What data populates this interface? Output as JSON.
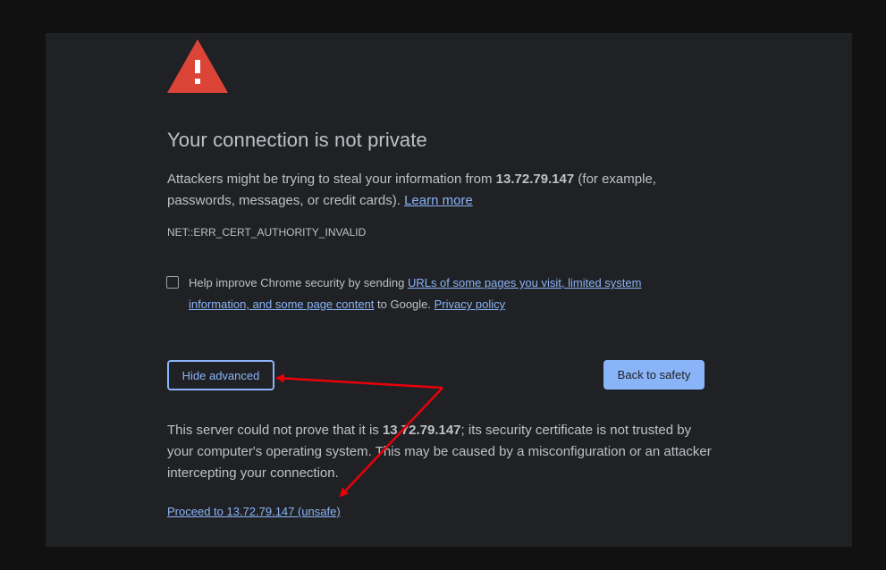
{
  "page": {
    "title": "Your connection is not private",
    "intro_prefix": "Attackers might be trying to steal your information from ",
    "host": "13.72.79.147",
    "intro_suffix": " (for example, passwords, messages, or credit cards). ",
    "learn_more": "Learn more",
    "error_code": "NET::ERR_CERT_AUTHORITY_INVALID"
  },
  "optin": {
    "checked": false,
    "text_prefix": "Help improve Chrome security by sending ",
    "link_urls": "URLs of some pages you visit, limited system information, and some page content",
    "text_middle": " to Google. ",
    "link_privacy": "Privacy policy"
  },
  "buttons": {
    "hide_advanced": "Hide advanced",
    "back_to_safety": "Back to safety"
  },
  "details": {
    "prefix": "This server could not prove that it is ",
    "host": "13.72.79.147",
    "suffix": "; its security certificate is not trusted by your computer's operating system. This may be caused by a misconfiguration or an attacker intercepting your connection.",
    "proceed_link": "Proceed to 13.72.79.147 (unsafe)"
  },
  "colors": {
    "background": "#202124",
    "outer_background": "#111111",
    "text": "#bdc1c6",
    "link": "#8ab4f8",
    "warning_red": "#db4437",
    "annotation_arrow": "#e8000b"
  },
  "icons": {
    "warning": "warning-triangle-icon",
    "annotation": "red-arrow-annotation"
  }
}
